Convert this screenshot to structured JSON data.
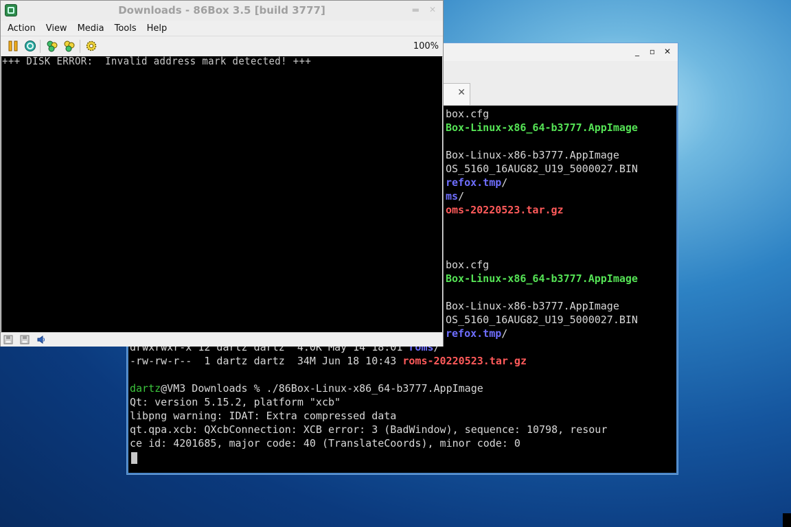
{
  "box_window": {
    "title": "Downloads - 86Box 3.5 [build 3777]",
    "menu": [
      "Action",
      "View",
      "Media",
      "Tools",
      "Help"
    ],
    "toolbar": {
      "icons": [
        "pause-icon",
        "reset-icon",
        "ctrl-alt-del-icon",
        "ctrl-alt-esc-icon",
        "settings-icon"
      ],
      "zoom": "100%"
    },
    "screen_text": "+++ DISK ERROR:  Invalid address mark detected! +++",
    "status_icons": [
      "floppy-drive-a-icon",
      "floppy-drive-b-icon",
      "sound-icon"
    ]
  },
  "terminal_window": {
    "controls": [
      "_",
      "▫",
      "✕"
    ],
    "tab_close": "✕",
    "lines": [
      {
        "segments": [
          {
            "text": "box.cfg",
            "style": "normal"
          }
        ]
      },
      {
        "segments": [
          {
            "text": "Box-Linux-x86_64-b3777.AppImage",
            "style": "green"
          }
        ]
      },
      {
        "segments": [
          {
            "text": "",
            "style": "normal"
          }
        ]
      },
      {
        "segments": [
          {
            "text": "Box-Linux-x86-b3777.AppImage",
            "style": "normal"
          }
        ]
      },
      {
        "segments": [
          {
            "text": "OS_5160_16AUG82_U19_5000027.BIN",
            "style": "normal"
          }
        ]
      },
      {
        "segments": [
          {
            "text": "refox.tmp",
            "style": "blue"
          },
          {
            "text": "/",
            "style": "normal"
          }
        ]
      },
      {
        "segments": [
          {
            "text": "ms",
            "style": "blue"
          },
          {
            "text": "/",
            "style": "normal"
          }
        ]
      },
      {
        "segments": [
          {
            "text": "oms-20220523.tar.gz",
            "style": "red"
          }
        ]
      },
      {
        "segments": [
          {
            "text": "",
            "style": "normal"
          }
        ]
      },
      {
        "segments": [
          {
            "text": "",
            "style": "normal"
          }
        ]
      },
      {
        "segments": [
          {
            "text": "",
            "style": "normal"
          }
        ]
      },
      {
        "segments": [
          {
            "text": "box.cfg",
            "style": "normal"
          }
        ]
      },
      {
        "segments": [
          {
            "text": "Box-Linux-x86_64-b3777.AppImage",
            "style": "green"
          }
        ]
      },
      {
        "segments": [
          {
            "text": "",
            "style": "normal"
          }
        ]
      },
      {
        "segments": [
          {
            "text": "Box-Linux-x86-b3777.AppImage",
            "style": "normal"
          }
        ]
      },
      {
        "segments": [
          {
            "text": "OS_5160_16AUG82_U19_5000027.BIN",
            "style": "normal"
          }
        ]
      },
      {
        "segments": [
          {
            "text": "refox.tmp",
            "style": "blue"
          },
          {
            "text": "/",
            "style": "normal"
          }
        ]
      },
      {
        "segments": [
          {
            "text": "drwxrwxr-x 12 dartz dartz  4.0K May 14 18:01 ",
            "style": "normal"
          },
          {
            "text": "roms",
            "style": "blue"
          },
          {
            "text": "/",
            "style": "normal"
          }
        ]
      },
      {
        "segments": [
          {
            "text": "-rw-rw-r--  1 dartz dartz  34M Jun 18 10:43 ",
            "style": "normal"
          },
          {
            "text": "roms-20220523.tar.gz",
            "style": "red"
          }
        ]
      },
      {
        "segments": [
          {
            "text": "",
            "style": "normal"
          }
        ]
      },
      {
        "segments": [
          {
            "text": "dartz",
            "style": "user"
          },
          {
            "text": "@VM3 Downloads % ./86Box-Linux-x86_64-b3777.AppImage",
            "style": "normal"
          }
        ]
      },
      {
        "segments": [
          {
            "text": "Qt: version 5.15.2, platform \"xcb\"",
            "style": "normal"
          }
        ]
      },
      {
        "segments": [
          {
            "text": "libpng warning: IDAT: Extra compressed data",
            "style": "normal"
          }
        ]
      },
      {
        "segments": [
          {
            "text": "qt.qpa.xcb: QXcbConnection: XCB error: 3 (BadWindow), sequence: 10798, resour",
            "style": "normal"
          }
        ]
      },
      {
        "segments": [
          {
            "text": "ce id: 4201685, major code: 40 (TranslateCoords), minor code: 0",
            "style": "normal"
          }
        ]
      }
    ]
  }
}
